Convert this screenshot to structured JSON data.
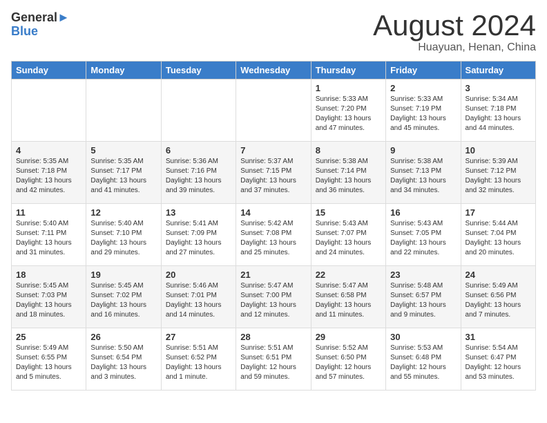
{
  "header": {
    "logo_line1": "General",
    "logo_line2": "Blue",
    "month_title": "August 2024",
    "location": "Huayuan, Henan, China"
  },
  "days_of_week": [
    "Sunday",
    "Monday",
    "Tuesday",
    "Wednesday",
    "Thursday",
    "Friday",
    "Saturday"
  ],
  "weeks": [
    [
      {
        "day": "",
        "info": ""
      },
      {
        "day": "",
        "info": ""
      },
      {
        "day": "",
        "info": ""
      },
      {
        "day": "",
        "info": ""
      },
      {
        "day": "1",
        "info": "Sunrise: 5:33 AM\nSunset: 7:20 PM\nDaylight: 13 hours\nand 47 minutes."
      },
      {
        "day": "2",
        "info": "Sunrise: 5:33 AM\nSunset: 7:19 PM\nDaylight: 13 hours\nand 45 minutes."
      },
      {
        "day": "3",
        "info": "Sunrise: 5:34 AM\nSunset: 7:18 PM\nDaylight: 13 hours\nand 44 minutes."
      }
    ],
    [
      {
        "day": "4",
        "info": "Sunrise: 5:35 AM\nSunset: 7:18 PM\nDaylight: 13 hours\nand 42 minutes."
      },
      {
        "day": "5",
        "info": "Sunrise: 5:35 AM\nSunset: 7:17 PM\nDaylight: 13 hours\nand 41 minutes."
      },
      {
        "day": "6",
        "info": "Sunrise: 5:36 AM\nSunset: 7:16 PM\nDaylight: 13 hours\nand 39 minutes."
      },
      {
        "day": "7",
        "info": "Sunrise: 5:37 AM\nSunset: 7:15 PM\nDaylight: 13 hours\nand 37 minutes."
      },
      {
        "day": "8",
        "info": "Sunrise: 5:38 AM\nSunset: 7:14 PM\nDaylight: 13 hours\nand 36 minutes."
      },
      {
        "day": "9",
        "info": "Sunrise: 5:38 AM\nSunset: 7:13 PM\nDaylight: 13 hours\nand 34 minutes."
      },
      {
        "day": "10",
        "info": "Sunrise: 5:39 AM\nSunset: 7:12 PM\nDaylight: 13 hours\nand 32 minutes."
      }
    ],
    [
      {
        "day": "11",
        "info": "Sunrise: 5:40 AM\nSunset: 7:11 PM\nDaylight: 13 hours\nand 31 minutes."
      },
      {
        "day": "12",
        "info": "Sunrise: 5:40 AM\nSunset: 7:10 PM\nDaylight: 13 hours\nand 29 minutes."
      },
      {
        "day": "13",
        "info": "Sunrise: 5:41 AM\nSunset: 7:09 PM\nDaylight: 13 hours\nand 27 minutes."
      },
      {
        "day": "14",
        "info": "Sunrise: 5:42 AM\nSunset: 7:08 PM\nDaylight: 13 hours\nand 25 minutes."
      },
      {
        "day": "15",
        "info": "Sunrise: 5:43 AM\nSunset: 7:07 PM\nDaylight: 13 hours\nand 24 minutes."
      },
      {
        "day": "16",
        "info": "Sunrise: 5:43 AM\nSunset: 7:05 PM\nDaylight: 13 hours\nand 22 minutes."
      },
      {
        "day": "17",
        "info": "Sunrise: 5:44 AM\nSunset: 7:04 PM\nDaylight: 13 hours\nand 20 minutes."
      }
    ],
    [
      {
        "day": "18",
        "info": "Sunrise: 5:45 AM\nSunset: 7:03 PM\nDaylight: 13 hours\nand 18 minutes."
      },
      {
        "day": "19",
        "info": "Sunrise: 5:45 AM\nSunset: 7:02 PM\nDaylight: 13 hours\nand 16 minutes."
      },
      {
        "day": "20",
        "info": "Sunrise: 5:46 AM\nSunset: 7:01 PM\nDaylight: 13 hours\nand 14 minutes."
      },
      {
        "day": "21",
        "info": "Sunrise: 5:47 AM\nSunset: 7:00 PM\nDaylight: 13 hours\nand 12 minutes."
      },
      {
        "day": "22",
        "info": "Sunrise: 5:47 AM\nSunset: 6:58 PM\nDaylight: 13 hours\nand 11 minutes."
      },
      {
        "day": "23",
        "info": "Sunrise: 5:48 AM\nSunset: 6:57 PM\nDaylight: 13 hours\nand 9 minutes."
      },
      {
        "day": "24",
        "info": "Sunrise: 5:49 AM\nSunset: 6:56 PM\nDaylight: 13 hours\nand 7 minutes."
      }
    ],
    [
      {
        "day": "25",
        "info": "Sunrise: 5:49 AM\nSunset: 6:55 PM\nDaylight: 13 hours\nand 5 minutes."
      },
      {
        "day": "26",
        "info": "Sunrise: 5:50 AM\nSunset: 6:54 PM\nDaylight: 13 hours\nand 3 minutes."
      },
      {
        "day": "27",
        "info": "Sunrise: 5:51 AM\nSunset: 6:52 PM\nDaylight: 13 hours\nand 1 minute."
      },
      {
        "day": "28",
        "info": "Sunrise: 5:51 AM\nSunset: 6:51 PM\nDaylight: 12 hours\nand 59 minutes."
      },
      {
        "day": "29",
        "info": "Sunrise: 5:52 AM\nSunset: 6:50 PM\nDaylight: 12 hours\nand 57 minutes."
      },
      {
        "day": "30",
        "info": "Sunrise: 5:53 AM\nSunset: 6:48 PM\nDaylight: 12 hours\nand 55 minutes."
      },
      {
        "day": "31",
        "info": "Sunrise: 5:54 AM\nSunset: 6:47 PM\nDaylight: 12 hours\nand 53 minutes."
      }
    ]
  ]
}
